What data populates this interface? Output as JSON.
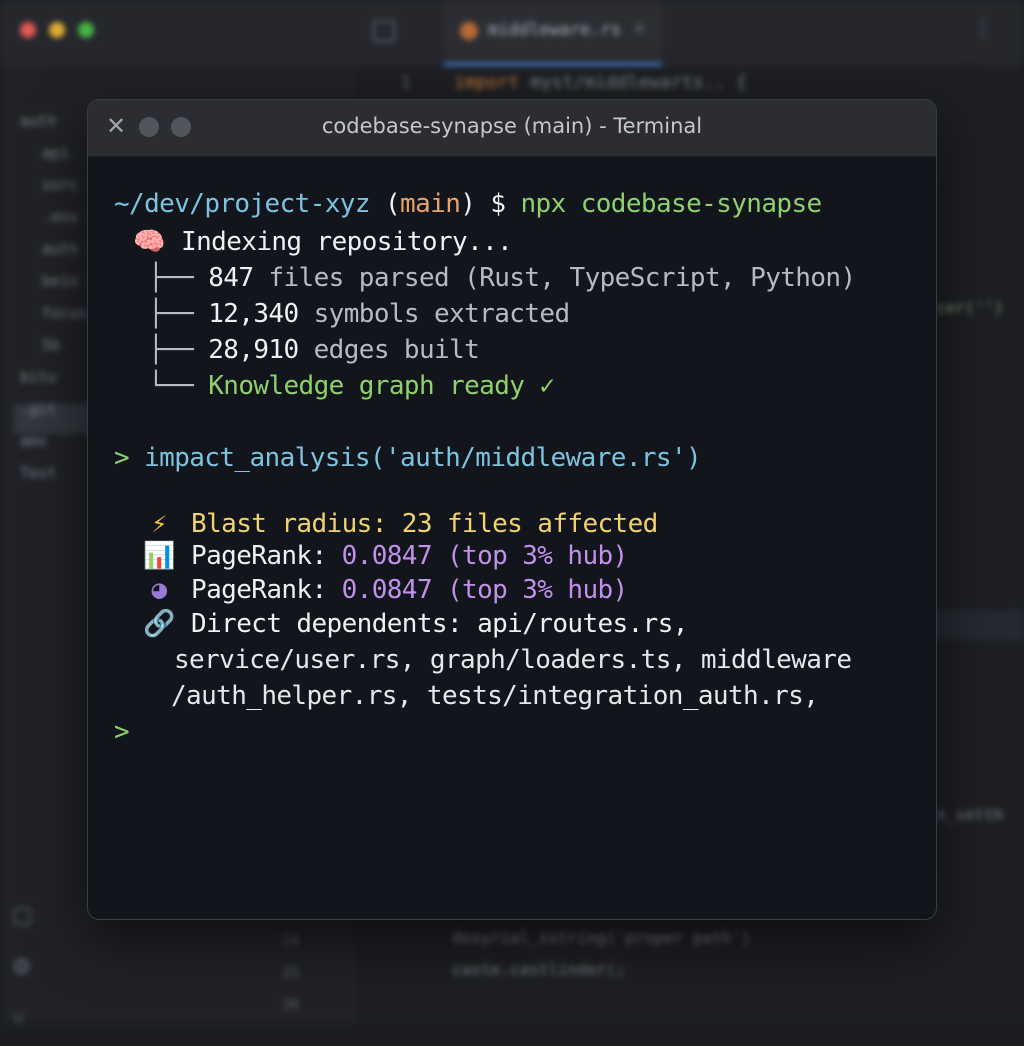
{
  "background_window": {
    "active_tab_label": "middleware.rs",
    "tab_close_glyph": "×",
    "more_glyph": "⋮",
    "import_line": {
      "keyword": "import",
      "rest": " myst/middlewarts.. {"
    },
    "line_number": "1",
    "sidebar_items": [
      "auth",
      "api",
      "sorc",
      ".env",
      "auth",
      "bein",
      "focus",
      "5b",
      "bitu",
      ".git",
      "ams",
      "Test"
    ],
    "gutter_numbers": [
      "24",
      "25",
      "26"
    ],
    "code_lines": [
      "dosyrial_sstring('proper path')",
      "caste.castlinder(;"
    ],
    "right_fragments": [
      "cer('')",
      "n_setth"
    ]
  },
  "terminal": {
    "title": "codebase-synapse (main) - Terminal",
    "close_glyph": "✕",
    "prompt": {
      "path": "~/dev/project-xyz",
      "branch_open": " (",
      "branch": "main",
      "branch_close": ")",
      "dollar": " $ ",
      "command": "npx codebase-synapse"
    },
    "indexing": {
      "icon": "brain-icon",
      "icon_glyph": "🧠",
      "text": " Indexing repository..."
    },
    "tree": [
      {
        "branch": "├── ",
        "num": "847",
        "text": " files parsed (Rust, TypeScript, Python)"
      },
      {
        "branch": "├── ",
        "num": "12,340",
        "text": " symbols extracted"
      },
      {
        "branch": "├── ",
        "num": "28,910",
        "text": " edges built"
      }
    ],
    "ready": {
      "branch": "└── ",
      "text": "Knowledge graph ready ",
      "check": "✓"
    },
    "query": {
      "caret": "> ",
      "text": "impact_analysis('auth/middleware.rs')"
    },
    "blast": {
      "icon_glyph": "⚡",
      "text": " Blast radius: 23 files affected"
    },
    "pagerank_1": {
      "icon_glyph": "📊",
      "label": " PageRank: ",
      "value": "0.0847 (top 3% hub)"
    },
    "pagerank_2": {
      "icon_glyph": "◕",
      "label": " PageRank: ",
      "value": "0.0847 (top 3% hub)"
    },
    "dependents": {
      "icon_glyph": "🔗",
      "line1": " Direct dependents: api/routes.rs,",
      "line2": "service/user.rs, graph/loaders.ts, middleware",
      "line3": "/auth_helper.rs, tests/integration_auth.rs,"
    },
    "final_prompt": ">"
  },
  "colors": {
    "path": "#7cc3df",
    "branch": "#e6a36b",
    "command": "#8ed16c",
    "value_purple": "#c190e8",
    "blast_yellow": "#f0d36e"
  }
}
